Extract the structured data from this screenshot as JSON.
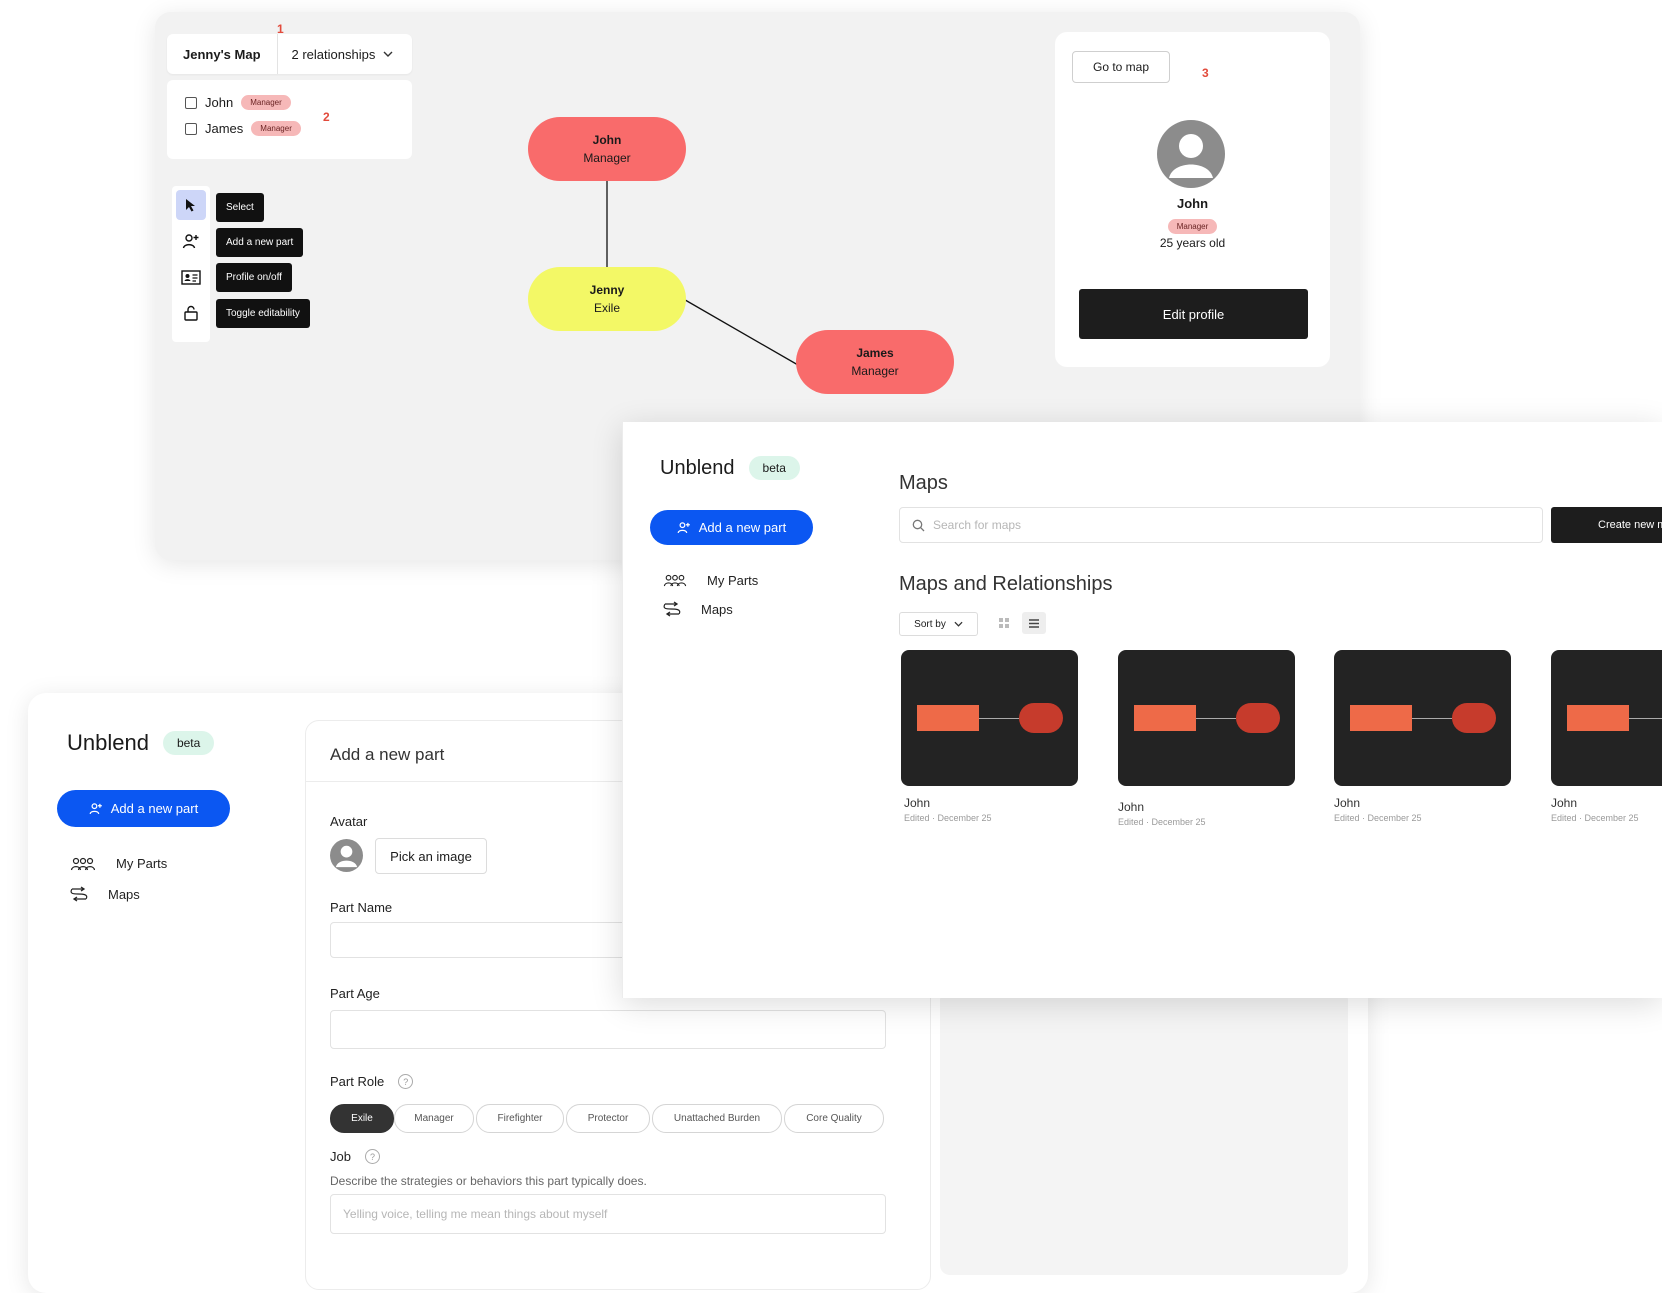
{
  "map_editor": {
    "map_title": "Jenny's Map",
    "relationships_label": "2 relationships",
    "marker_1": "1",
    "marker_2": "2",
    "marker_3": "3",
    "relationships": [
      {
        "name": "John",
        "role": "Manager"
      },
      {
        "name": "James",
        "role": "Manager"
      }
    ],
    "tools": [
      "Select",
      "Add a new part",
      "Profile on/off",
      "Toggle editability"
    ],
    "nodes": [
      {
        "name": "John",
        "role": "Manager",
        "color": "#f96b6b"
      },
      {
        "name": "Jenny",
        "role": "Exile",
        "color": "#f3f866"
      },
      {
        "name": "James",
        "role": "Manager",
        "color": "#f96b6b"
      }
    ],
    "profile": {
      "go_to_map": "Go to map",
      "name": "John",
      "role": "Manager",
      "age": "25 years old",
      "edit_profile": "Edit profile"
    }
  },
  "app": {
    "brand": "Unblend",
    "beta": "beta",
    "add_part_button": "Add a new part",
    "nav": [
      "My Parts",
      "Maps"
    ],
    "accent_color": "#0b57f2"
  },
  "add_part_form": {
    "title": "Add a new part",
    "avatar_label": "Avatar",
    "pick_image": "Pick an image",
    "part_name_label": "Part Name",
    "part_age_label": "Part Age",
    "part_role_label": "Part Role",
    "roles": [
      "Exile",
      "Manager",
      "Firefighter",
      "Protector",
      "Unattached Burden",
      "Core Quality"
    ],
    "selected_role": "Exile",
    "job_label": "Job",
    "job_help": "Describe the strategies or behaviors this part typically does.",
    "job_placeholder": "Yelling voice, telling me mean things about myself"
  },
  "maps_page": {
    "title": "Maps",
    "search_placeholder": "Search for maps",
    "create_button": "Create new m",
    "section_title": "Maps and Relationships",
    "sort_label": "Sort by",
    "maps": [
      {
        "name": "John",
        "edited": "Edited · December 25"
      },
      {
        "name": "John",
        "edited": "Edited · December 25"
      },
      {
        "name": "John",
        "edited": "Edited · December 25"
      },
      {
        "name": "John",
        "edited": "Edited · December 25"
      }
    ]
  }
}
